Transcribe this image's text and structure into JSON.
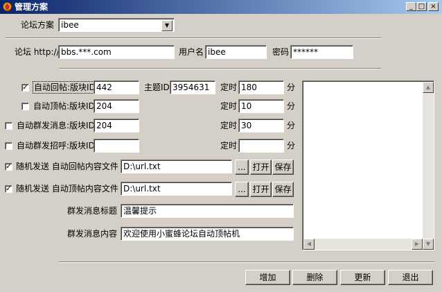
{
  "window": {
    "title": "管理方案",
    "minimize": "_",
    "maximize": "□",
    "close": "×"
  },
  "scheme": {
    "label": "论坛方案",
    "value": "ibee"
  },
  "forum": {
    "label": "论坛 http://",
    "url": "bbs.***.com"
  },
  "user": {
    "label": "用户名",
    "value": "ibee"
  },
  "password": {
    "label": "密码",
    "value": "******"
  },
  "rows": [
    {
      "label": "自动回帖:版块ID",
      "checked": true,
      "board_id": "442",
      "topic_label": "主题ID",
      "topic_id": "3954631",
      "timer_label": "定时",
      "timer": "180",
      "unit": "分"
    },
    {
      "label": "自动顶帖:版块ID",
      "checked": false,
      "board_id": "204",
      "timer_label": "定时",
      "timer": "10",
      "unit": "分"
    },
    {
      "label": "自动群发消息:版块ID",
      "checked": false,
      "board_id": "204",
      "timer_label": "定时",
      "timer": "30",
      "unit": "分"
    },
    {
      "label": "自动群发招呼:版块ID",
      "checked": false,
      "board_id": "",
      "timer_label": "定时",
      "timer": "",
      "unit": "分"
    }
  ],
  "file_rows": [
    {
      "label": "随机发送 自动回帖内容文件",
      "checked": true,
      "path": "D:\\url.txt",
      "browse": "...",
      "open": "打开",
      "save": "保存"
    },
    {
      "label": "随机发送 自动顶帖内容文件",
      "checked": true,
      "path": "D:\\url.txt",
      "browse": "...",
      "open": "打开",
      "save": "保存"
    }
  ],
  "message": {
    "title_label": "群发消息标题",
    "title_value": "温馨提示",
    "content_label": "群发消息内容",
    "content_value": "欢迎使用小蜜蜂论坛自动顶帖机"
  },
  "buttons": {
    "add": "增加",
    "delete": "删除",
    "update": "更新",
    "exit": "退出"
  },
  "check_mark": "✓",
  "icons": {
    "dropdown": "▼",
    "up": "▲",
    "down": "▼",
    "left": "◀",
    "right": "▶"
  }
}
